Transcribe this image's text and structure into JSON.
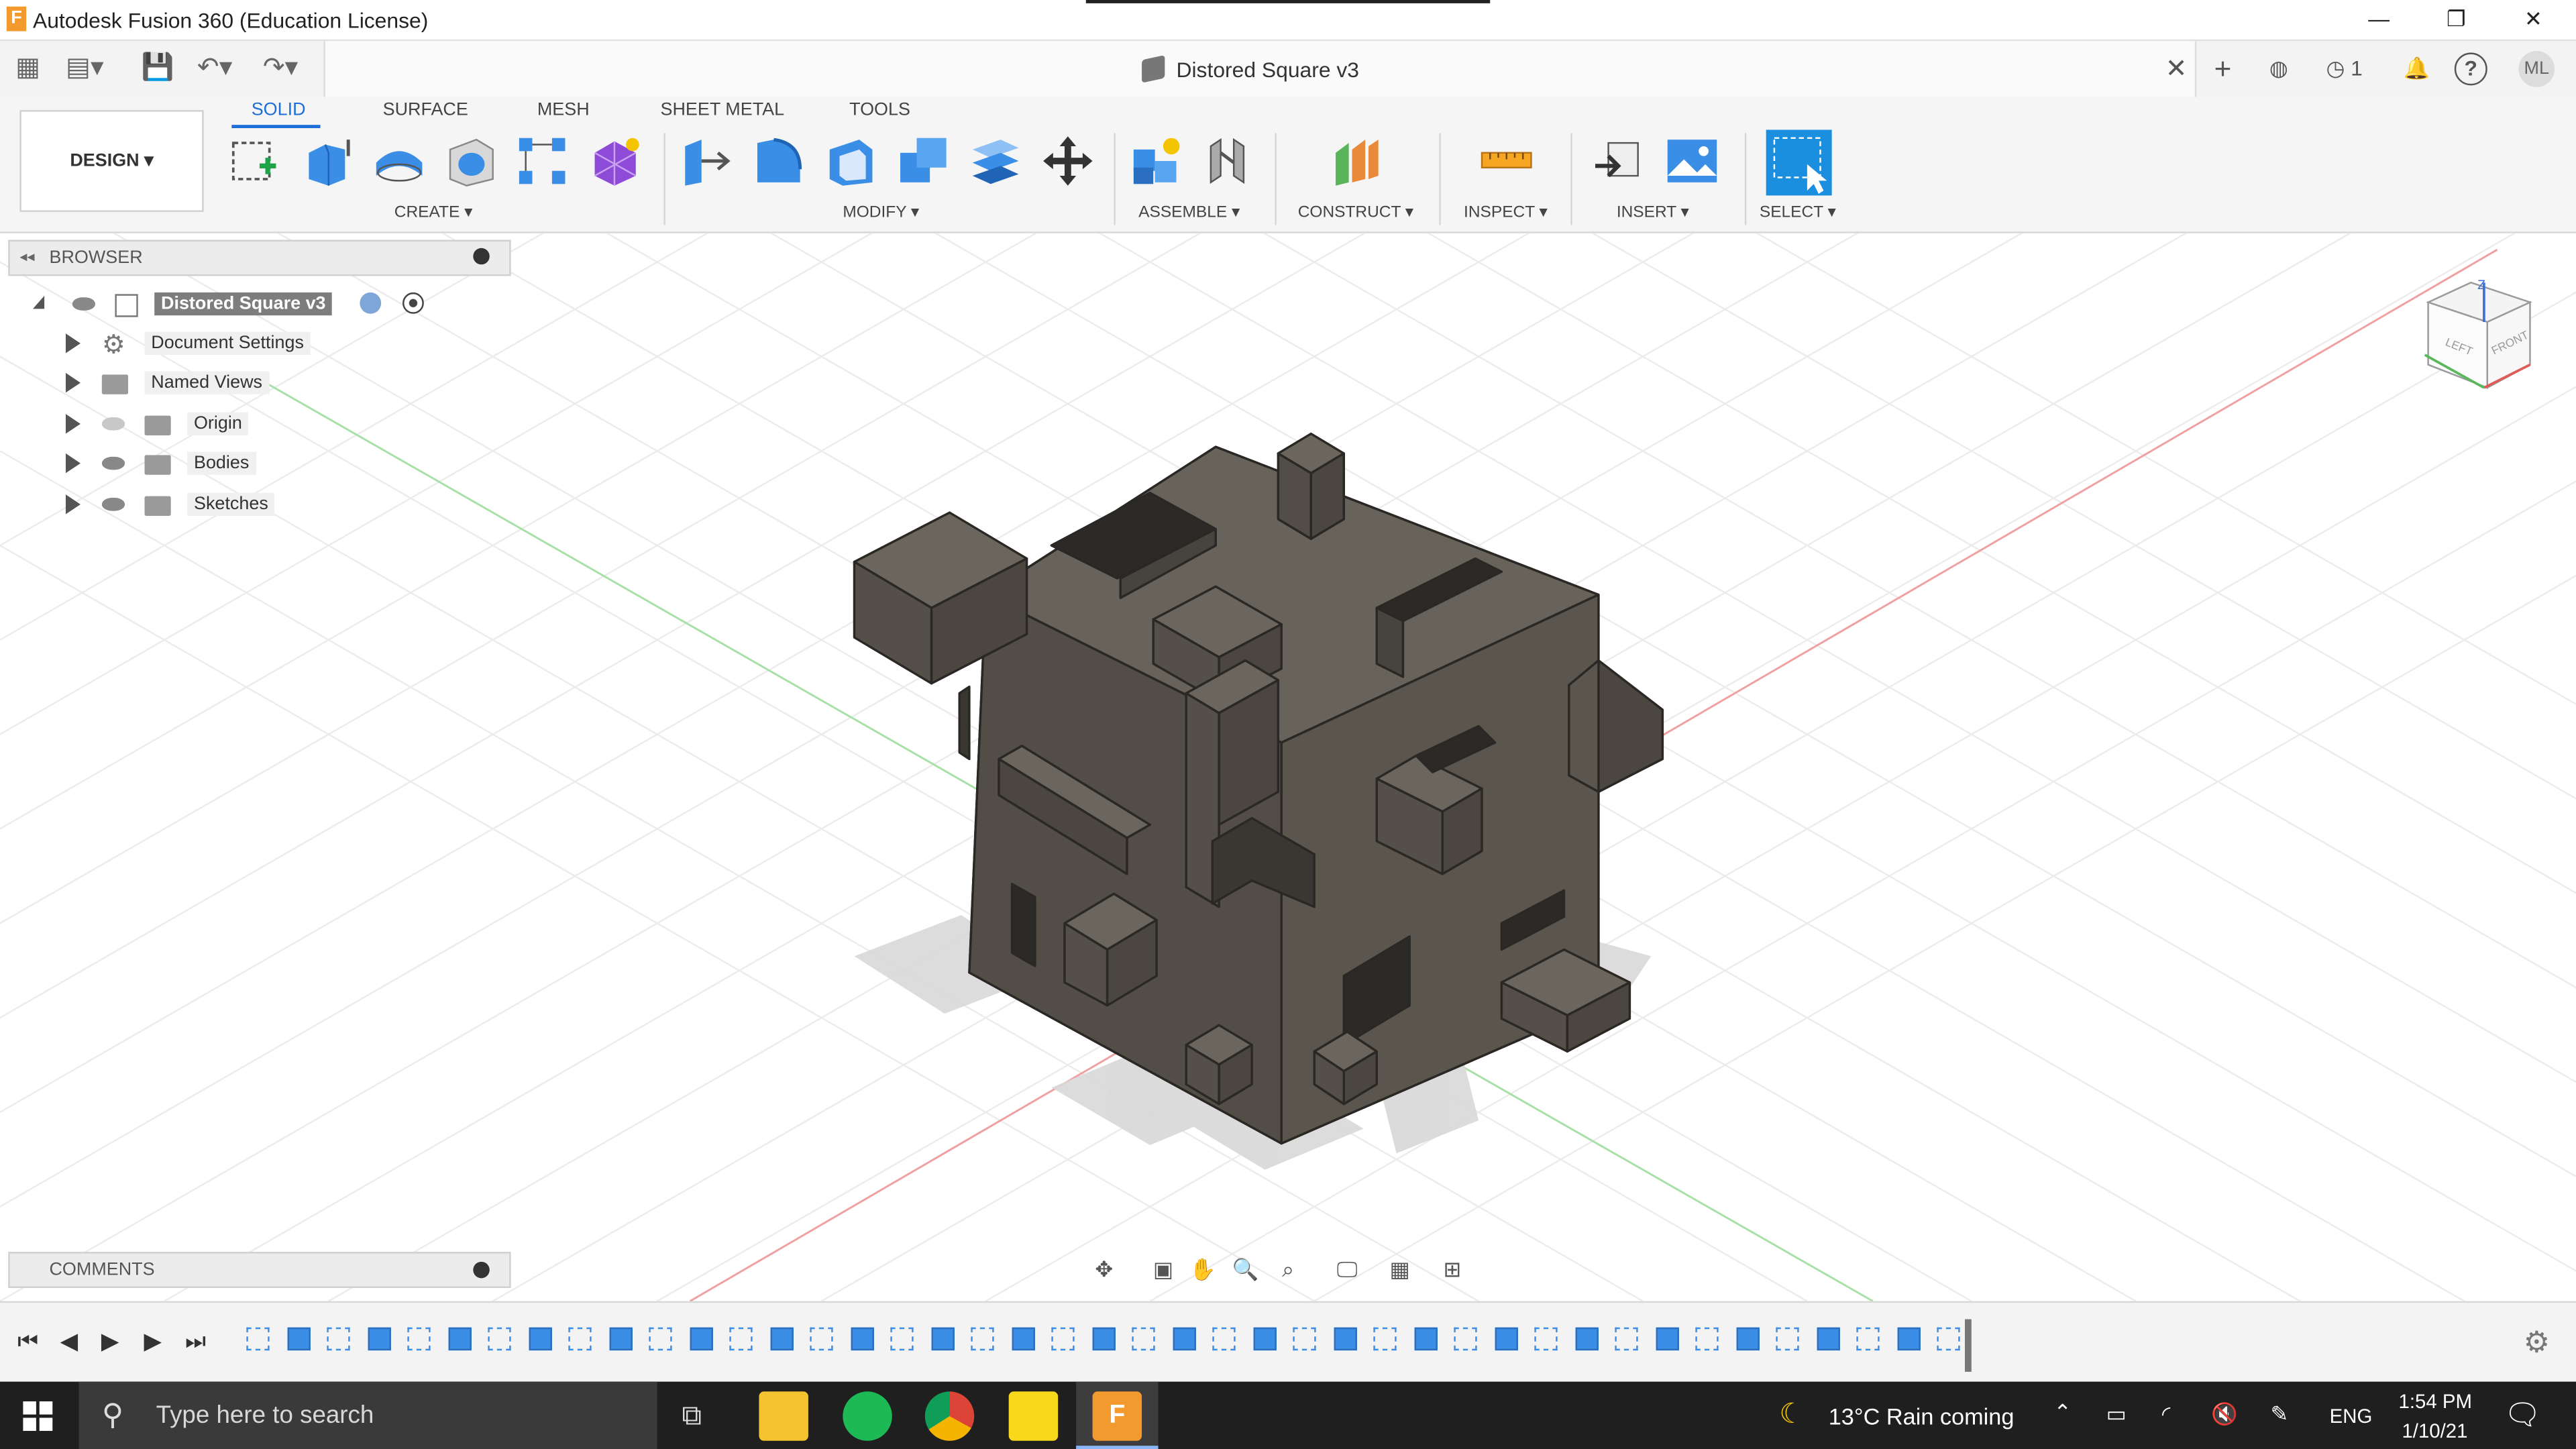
{
  "window": {
    "title": "Autodesk Fusion 360 (Education License)",
    "logo_letter": "F",
    "minimize": "—",
    "restore": "❐",
    "close": "✕"
  },
  "document": {
    "title": "Distored Square v3",
    "close": "✕"
  },
  "header_right": {
    "jobs_count": "1",
    "avatar": "ML",
    "help": "?"
  },
  "workspace": {
    "label": "DESIGN ▾"
  },
  "tabs": [
    {
      "label": "SOLID",
      "active": true
    },
    {
      "label": "SURFACE"
    },
    {
      "label": "MESH"
    },
    {
      "label": "SHEET METAL"
    },
    {
      "label": "TOOLS"
    }
  ],
  "groups": [
    {
      "label": "CREATE ▾"
    },
    {
      "label": "MODIFY ▾"
    },
    {
      "label": "ASSEMBLE ▾"
    },
    {
      "label": "CONSTRUCT ▾"
    },
    {
      "label": "INSPECT ▾"
    },
    {
      "label": "INSERT ▾"
    },
    {
      "label": "SELECT ▾"
    }
  ],
  "browser": {
    "title": "BROWSER",
    "root": "Distored Square v3",
    "items": [
      {
        "label": "Document Settings",
        "icon": "gear-icon"
      },
      {
        "label": "Named Views",
        "icon": "folder-icon"
      },
      {
        "label": "Origin",
        "icon": "folder-icon",
        "visible": false
      },
      {
        "label": "Bodies",
        "icon": "folder-icon",
        "visible": true
      },
      {
        "label": "Sketches",
        "icon": "folder-icon",
        "visible": true
      }
    ]
  },
  "comments": {
    "title": "COMMENTS"
  },
  "viewcube": {
    "top": "Z",
    "left": "LEFT",
    "front": "FRONT"
  },
  "taskbar": {
    "search_placeholder": "Type here to search",
    "weather": "13°C  Rain coming",
    "lang": "ENG",
    "time": "1:54 PM",
    "date": "1/10/21"
  },
  "colors": {
    "accent": "#1d6fd6",
    "model": "#5e5950",
    "timeline_feature": "#3a8ee6",
    "taskbar": "#1f1f1f"
  }
}
